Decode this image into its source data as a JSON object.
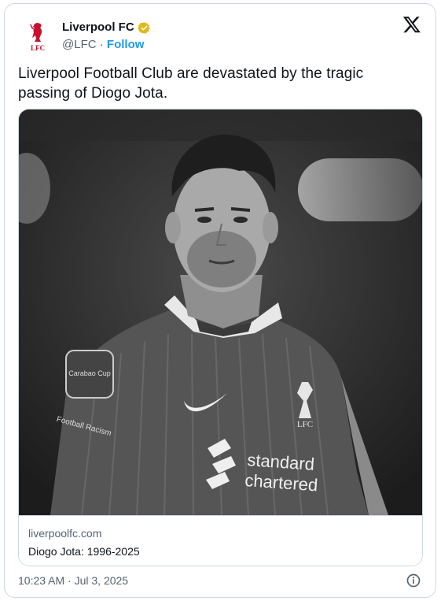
{
  "account": {
    "display_name": "Liverpool FC",
    "handle": "@LFC",
    "separator": " · ",
    "follow_label": "Follow",
    "logo_text": "LFC",
    "verified_color": "#e2b719"
  },
  "tweet": {
    "text": "Liverpool Football Club are devastated by the tragic passing of Diogo Jota."
  },
  "media": {
    "description_icon": "player-photo",
    "jersey_sponsor": "standard chartered",
    "badge_text": "LFC",
    "sleeve_patch": "Carabao Cup",
    "sleeve_text": "Football Racism"
  },
  "link_card": {
    "domain": "liverpoolfc.com",
    "title": "Diogo Jota: 1996-2025"
  },
  "footer": {
    "timestamp": "10:23 AM · Jul 3, 2025"
  },
  "colors": {
    "accent": "#1d9bf0",
    "lfc_red": "#c8102e",
    "muted": "#536471"
  }
}
